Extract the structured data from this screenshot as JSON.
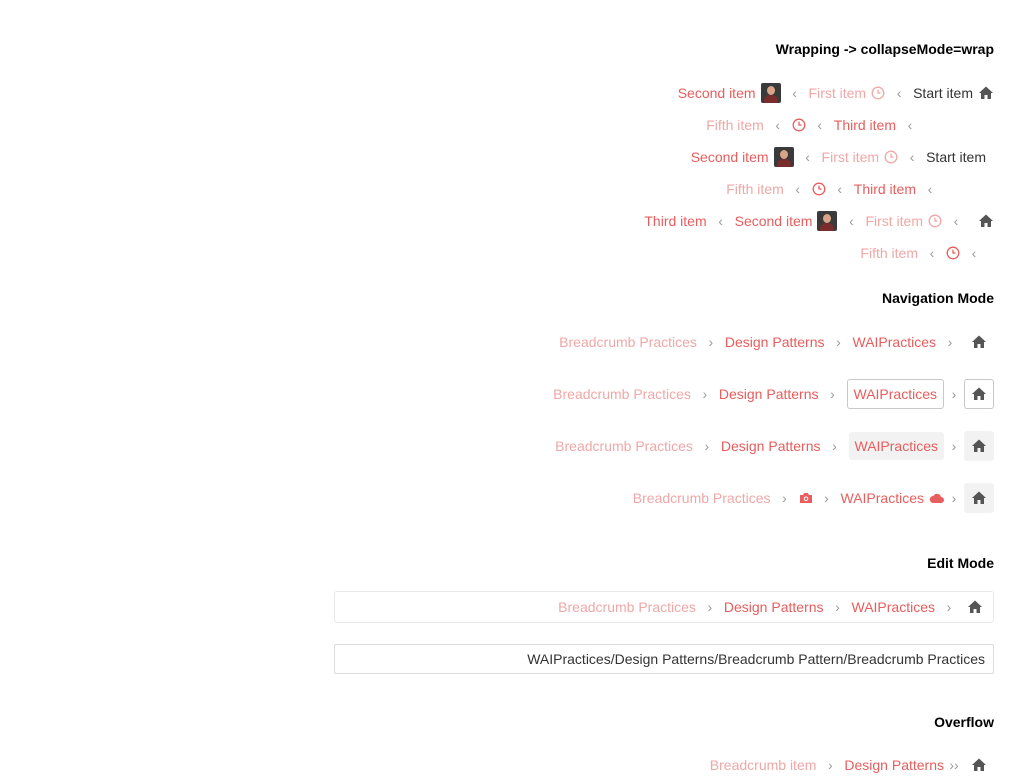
{
  "colors": {
    "accent": "#e85d5d",
    "muted": "#f0a7a7",
    "text": "#333333",
    "separator": "#9a9a9a"
  },
  "headings": {
    "wrapping": "Wrapping -> collapseMode=wrap",
    "navigation": "Navigation Mode",
    "edit": "Edit Mode",
    "overflow": "Overflow"
  },
  "wrap": {
    "second_item": "Second item",
    "first_item": "First item",
    "start_item": "Start item",
    "fifth_item": "Fifth item",
    "third_item": "Third item"
  },
  "nav": {
    "item1": "Breadcrumb Practices",
    "item2": "Design Patterns",
    "item3": "WAIPractices"
  },
  "edit": {
    "path_value": "WAIPractices/Design Patterns/Breadcrumb Pattern/Breadcrumb Practices"
  },
  "overflow": {
    "item1": "Breadcrumb item",
    "item2": "Design Patterns"
  },
  "icons": [
    "home-icon",
    "clock-icon",
    "avatar",
    "camera-icon",
    "cloud-icon",
    "chevron-left-icon",
    "chevron-right-icon"
  ]
}
